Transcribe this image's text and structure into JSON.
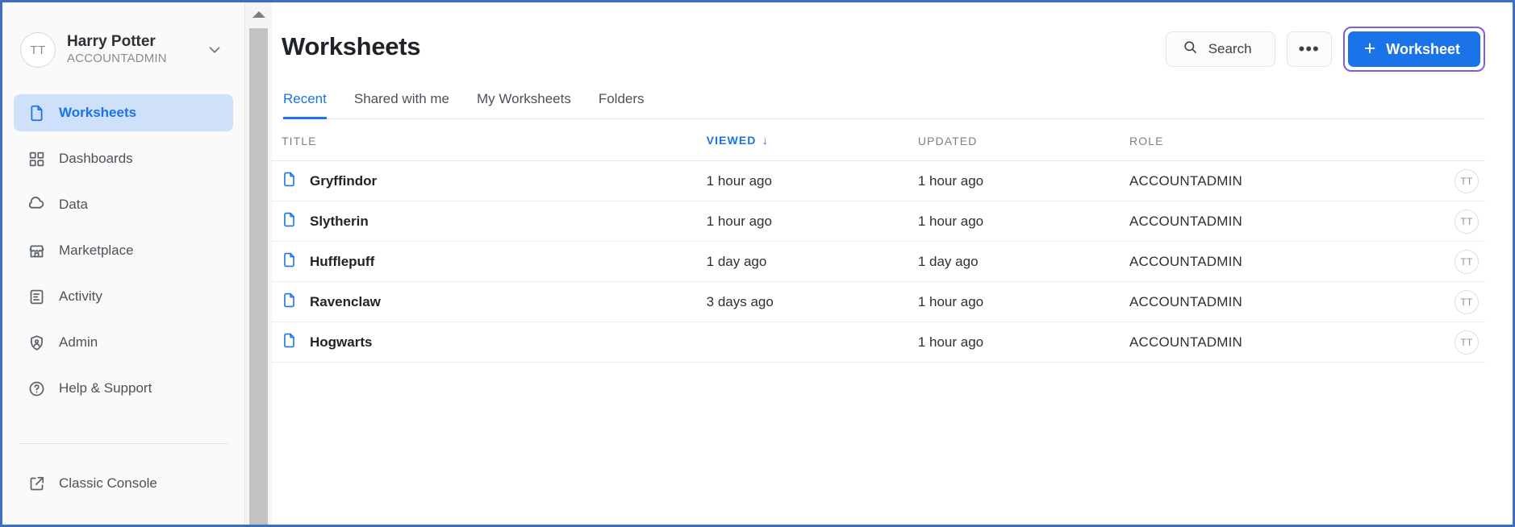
{
  "sidebar": {
    "account": {
      "initials": "TT",
      "name": "Harry Potter",
      "role": "ACCOUNTADMIN"
    },
    "items": [
      {
        "label": "Worksheets",
        "icon": "document-icon",
        "active": true
      },
      {
        "label": "Dashboards",
        "icon": "grid-icon",
        "active": false
      },
      {
        "label": "Data",
        "icon": "cloud-icon",
        "active": false
      },
      {
        "label": "Marketplace",
        "icon": "storefront-icon",
        "active": false
      },
      {
        "label": "Activity",
        "icon": "list-doc-icon",
        "active": false
      },
      {
        "label": "Admin",
        "icon": "shield-user-icon",
        "active": false
      },
      {
        "label": "Help & Support",
        "icon": "question-icon",
        "active": false
      }
    ],
    "bottom_items": [
      {
        "label": "Classic Console",
        "icon": "external-link-icon"
      }
    ]
  },
  "header": {
    "title": "Worksheets",
    "search_label": "Search",
    "more_label": "•••",
    "new_worksheet_label": "Worksheet",
    "new_worksheet_plus": "+"
  },
  "tabs": [
    {
      "label": "Recent",
      "active": true
    },
    {
      "label": "Shared with me",
      "active": false
    },
    {
      "label": "My Worksheets",
      "active": false
    },
    {
      "label": "Folders",
      "active": false
    }
  ],
  "table": {
    "columns": [
      {
        "key": "title",
        "label": "TITLE",
        "sorted": false,
        "sort_arrow": ""
      },
      {
        "key": "viewed",
        "label": "VIEWED",
        "sorted": true,
        "sort_arrow": "↓"
      },
      {
        "key": "updated",
        "label": "UPDATED",
        "sorted": false,
        "sort_arrow": ""
      },
      {
        "key": "role",
        "label": "ROLE",
        "sorted": false,
        "sort_arrow": ""
      }
    ],
    "rows": [
      {
        "title": "Gryffindor",
        "viewed": "1 hour ago",
        "updated": "1 hour ago",
        "role": "ACCOUNTADMIN",
        "owner": "TT"
      },
      {
        "title": "Slytherin",
        "viewed": "1 hour ago",
        "updated": "1 hour ago",
        "role": "ACCOUNTADMIN",
        "owner": "TT"
      },
      {
        "title": "Hufflepuff",
        "viewed": "1 day ago",
        "updated": "1 day ago",
        "role": "ACCOUNTADMIN",
        "owner": "TT"
      },
      {
        "title": "Ravenclaw",
        "viewed": "3 days ago",
        "updated": "1 hour ago",
        "role": "ACCOUNTADMIN",
        "owner": "TT"
      },
      {
        "title": "Hogwarts",
        "viewed": "",
        "updated": "1 hour ago",
        "role": "ACCOUNTADMIN",
        "owner": "TT"
      }
    ]
  },
  "colors": {
    "accent_blue": "#1a73e8",
    "focus_ring_purple": "#7b5cf0",
    "sidebar_bg": "#fafafa",
    "active_nav_bg": "#cfe0fb",
    "window_border": "#3c6ec4"
  }
}
